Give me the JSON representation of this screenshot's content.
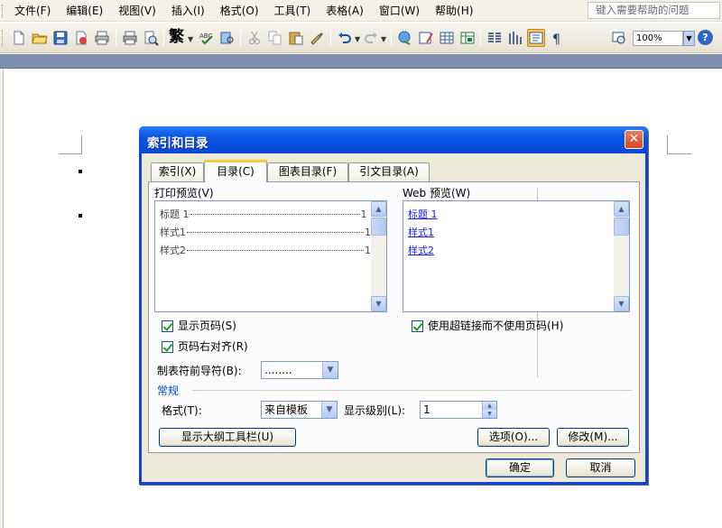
{
  "menubar": {
    "items": [
      "文件(F)",
      "编辑(E)",
      "视图(V)",
      "插入(I)",
      "格式(O)",
      "工具(T)",
      "表格(A)",
      "窗口(W)",
      "帮助(H)"
    ],
    "help_placeholder": "键入需要帮助的问题"
  },
  "toolbar": {
    "traditional_char": "繁",
    "zoom": "100%",
    "help_icon_text": "?"
  },
  "dialog": {
    "title": "索引和目录",
    "close_glyph": "✕",
    "tabs": [
      "索引(X)",
      "目录(C)",
      "图表目录(F)",
      "引文目录(A)"
    ],
    "active_tab": 1,
    "print_preview_label": "打印预览(V)",
    "print_preview_lines": [
      {
        "text": "标题 1",
        "page": "1"
      },
      {
        "text": "样式1",
        "page": "1"
      },
      {
        "text": "样式2",
        "page": "1"
      }
    ],
    "web_preview_label": "Web 预览(W)",
    "web_preview_links": [
      "标题 1",
      "样式1",
      "样式2"
    ],
    "show_page_numbers": "显示页码(S)",
    "right_align_page_numbers": "页码右对齐(R)",
    "tab_leader_label": "制表符前导符(B):",
    "tab_leader_value": "........",
    "use_hyperlinks": "使用超链接而不使用页码(H)",
    "general_group": "常规",
    "format_label": "格式(T):",
    "format_value": "来自模板",
    "show_levels_label": "显示级别(L):",
    "show_levels_value": "1",
    "outline_toolbar_button": "显示大纲工具栏(U)",
    "options_button": "选项(O)...",
    "modify_button": "修改(M)...",
    "ok_button": "确定",
    "cancel_button": "取消"
  }
}
